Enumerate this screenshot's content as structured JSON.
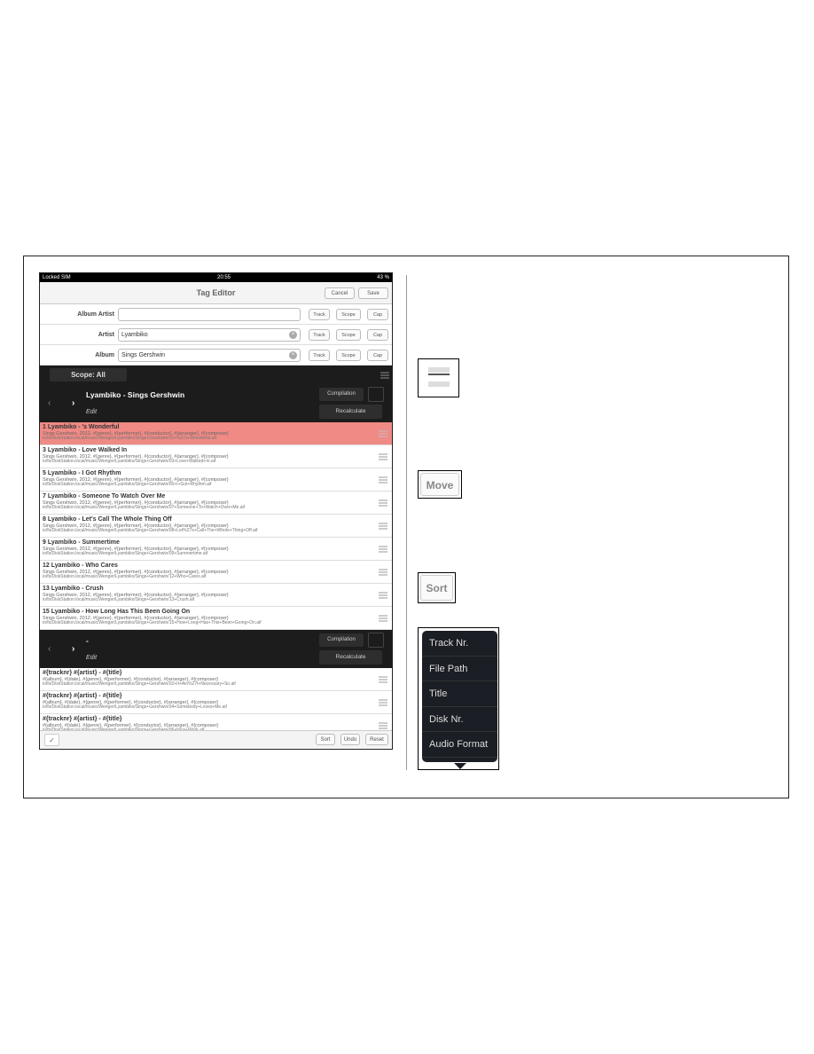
{
  "status": {
    "carrier": "Locked SIM",
    "time": "20:55",
    "battery": "43 %"
  },
  "nav": {
    "title": "Tag Editor",
    "cancel": "Cancel",
    "save": "Save"
  },
  "fields": [
    {
      "label": "Album Artist",
      "value": "",
      "track": "Track",
      "scope": "Scope",
      "cap": "Cap"
    },
    {
      "label": "Artist",
      "value": "Lyambiko",
      "track": "Track",
      "scope": "Scope",
      "cap": "Cap"
    },
    {
      "label": "Album",
      "value": "Sings Gershwin",
      "track": "Track",
      "scope": "Scope",
      "cap": "Cap"
    }
  ],
  "scope_button": "Scope: All",
  "albums": [
    {
      "title": "Lyambiko - Sings Gershwin",
      "edit": "Edit",
      "compilation": "Compilation",
      "recalculate": "Recalculate",
      "tracks": [
        {
          "name": "1 Lyambiko - 's Wonderful",
          "meta": "Sings Gershwin, 2012, #{genre}, #{performer}, #{conductor}, #{arranger}, #{composer}",
          "path": "io/fs/DiskStation.local/music/Wenger/Lyambiko/Sings+Gershwin/01+%27s+Wonderful.aif",
          "selected": true
        },
        {
          "name": "3 Lyambiko - Love Walked In",
          "meta": "Sings Gershwin, 2012, #{genre}, #{performer}, #{conductor}, #{arranger}, #{composer}",
          "path": "io/fs/DiskStation.local/music/Wenger/Lyambiko/Sings+Gershwin/03+Love+Walked+In.aif"
        },
        {
          "name": "5 Lyambiko - I Got Rhythm",
          "meta": "Sings Gershwin, 2012, #{genre}, #{performer}, #{conductor}, #{arranger}, #{composer}",
          "path": "io/fs/DiskStation.local/music/Wenger/Lyambiko/Sings+Gershwin/05+I+Got+Rhythm.aif"
        },
        {
          "name": "7 Lyambiko - Someone To Watch Over Me",
          "meta": "Sings Gershwin, 2012, #{genre}, #{performer}, #{conductor}, #{arranger}, #{composer}",
          "path": "io/fs/DiskStation.local/music/Wenger/Lyambiko/Sings+Gershwin/07+Someone+To+Watch+Over+Me.aif"
        },
        {
          "name": "8 Lyambiko - Let's Call The Whole Thing Off",
          "meta": "Sings Gershwin, 2012, #{genre}, #{performer}, #{conductor}, #{arranger}, #{composer}",
          "path": "io/fs/DiskStation.local/music/Wenger/Lyambiko/Sings+Gershwin/08+Let%27s+Call+The+Whole+Thing+Off.aif"
        },
        {
          "name": "9 Lyambiko - Summertime",
          "meta": "Sings Gershwin, 2012, #{genre}, #{performer}, #{conductor}, #{arranger}, #{composer}",
          "path": "io/fs/DiskStation.local/music/Wenger/Lyambiko/Sings+Gershwin/09+Summertime.aif"
        },
        {
          "name": "12 Lyambiko - Who Cares",
          "meta": "Sings Gershwin, 2012, #{genre}, #{performer}, #{conductor}, #{arranger}, #{composer}",
          "path": "io/fs/DiskStation.local/music/Wenger/Lyambiko/Sings+Gershwin/12+Who+Cares.aif"
        },
        {
          "name": "13 Lyambiko - Crush",
          "meta": "Sings Gershwin, 2012, #{genre}, #{performer}, #{conductor}, #{arranger}, #{composer}",
          "path": "io/fs/DiskStation.local/music/Wenger/Lyambiko/Sings+Gershwin/13+Crush.aif"
        },
        {
          "name": "15 Lyambiko - How Long Has This Been Going On",
          "meta": "Sings Gershwin, 2012, #{genre}, #{performer}, #{conductor}, #{arranger}, #{composer}",
          "path": "io/fs/DiskStation.local/music/Wenger/Lyambiko/Sings+Gershwin/15+How+Long+Has+This+Been+Going+On.aif"
        }
      ]
    },
    {
      "title": "-",
      "edit": "Edit",
      "compilation": "Compilation",
      "recalculate": "Recalculate",
      "tracks": [
        {
          "name": "#{tracknr} #{artist} - #{title}",
          "meta": "#{album}, #{date}, #{genre}, #{performer}, #{conductor}, #{arranger}, #{composer}",
          "path": "io/fs/DiskStation.local/music/Wenger/Lyambiko/Sings+Gershwin/02+It+Ain%27t+Necessary+So.aif"
        },
        {
          "name": "#{tracknr} #{artist} - #{title}",
          "meta": "#{album}, #{date}, #{genre}, #{performer}, #{conductor}, #{arranger}, #{composer}",
          "path": "io/fs/DiskStation.local/music/Wenger/Lyambiko/Sings+Gershwin/04+Somebody+Loves+Me.aif"
        },
        {
          "name": "#{tracknr} #{artist} - #{title}",
          "meta": "#{album}, #{date}, #{genre}, #{performer}, #{conductor}, #{arranger}, #{composer}",
          "path": "io/fs/DiskStation.local/music/Wenger/Lyambiko/Sings+Gershwin/06+Nice+Work.aif"
        }
      ]
    }
  ],
  "toolbar": {
    "check": "✓",
    "sort": "Sort",
    "undo": "Undo",
    "reset": "Reset"
  },
  "callouts": {
    "move": "Move",
    "sort": "Sort"
  },
  "sort_menu": [
    "Track Nr.",
    "File Path",
    "Title",
    "Disk Nr.",
    "Audio Format"
  ],
  "colors": {
    "selected_row": "#ef8a85",
    "dark_bar": "#1c1c1c"
  }
}
